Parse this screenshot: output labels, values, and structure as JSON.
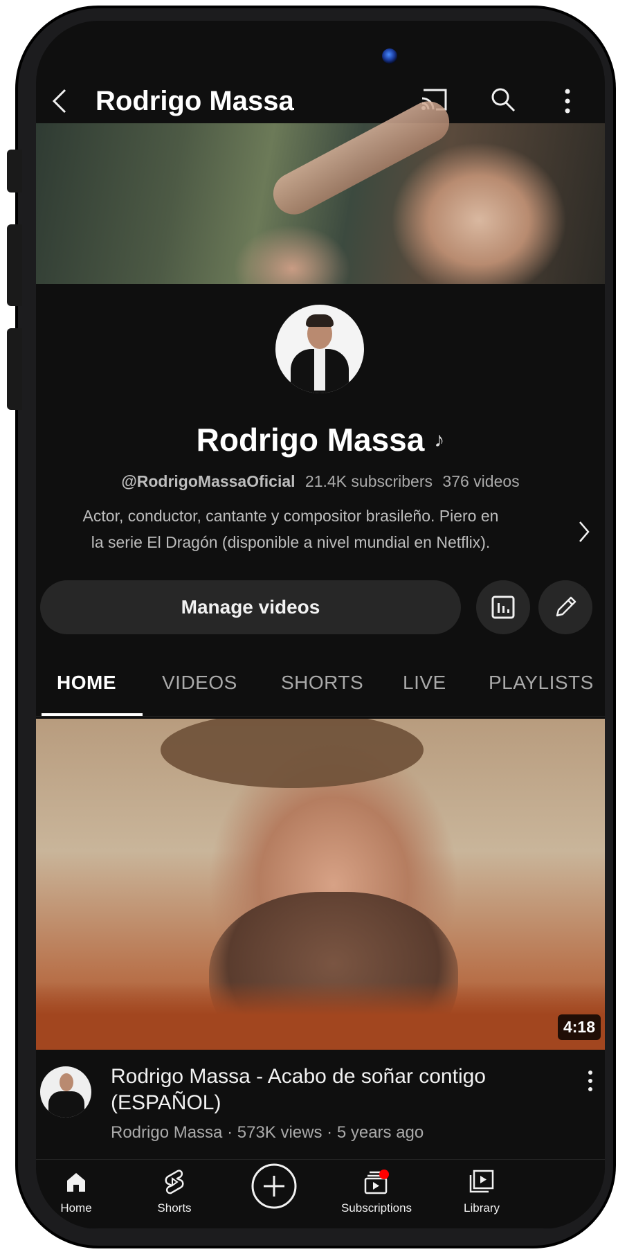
{
  "header": {
    "title": "Rodrigo Massa",
    "icons": [
      "back-icon",
      "cast-icon",
      "search-icon",
      "more-vertical-icon"
    ]
  },
  "channel": {
    "name": "Rodrigo Massa",
    "handle": "@RodrigoMassaOficial",
    "subscribers": "21.4K subscribers",
    "videos": "376 videos",
    "description_line1": "Actor, conductor, cantante y compositor brasileño. Piero en",
    "description_line2": "la serie El Dragón (disponible a nivel mundial en Netflix)."
  },
  "actions": {
    "manage_label": "Manage videos"
  },
  "tabs": [
    {
      "label": "HOME",
      "active": true
    },
    {
      "label": "VIDEOS",
      "active": false
    },
    {
      "label": "SHORTS",
      "active": false
    },
    {
      "label": "LIVE",
      "active": false
    },
    {
      "label": "PLAYLISTS",
      "active": false
    }
  ],
  "video": {
    "duration": "4:18",
    "title": "Rodrigo Massa - Acabo de soñar contigo (ESPAÑOL)",
    "channel": "Rodrigo Massa",
    "views": "573K views",
    "age": "5 years ago",
    "separator": "·"
  },
  "bottom_nav": [
    {
      "label": "Home",
      "icon": "home-icon"
    },
    {
      "label": "Shorts",
      "icon": "shorts-icon"
    },
    {
      "label": "",
      "icon": "create-plus-icon"
    },
    {
      "label": "Subscriptions",
      "icon": "subscriptions-icon"
    },
    {
      "label": "Library",
      "icon": "library-icon"
    }
  ],
  "colors": {
    "background": "#0f0f0f",
    "button_bg": "#272727",
    "notification_dot": "#ff0000",
    "camera": "#1a3a9a"
  }
}
